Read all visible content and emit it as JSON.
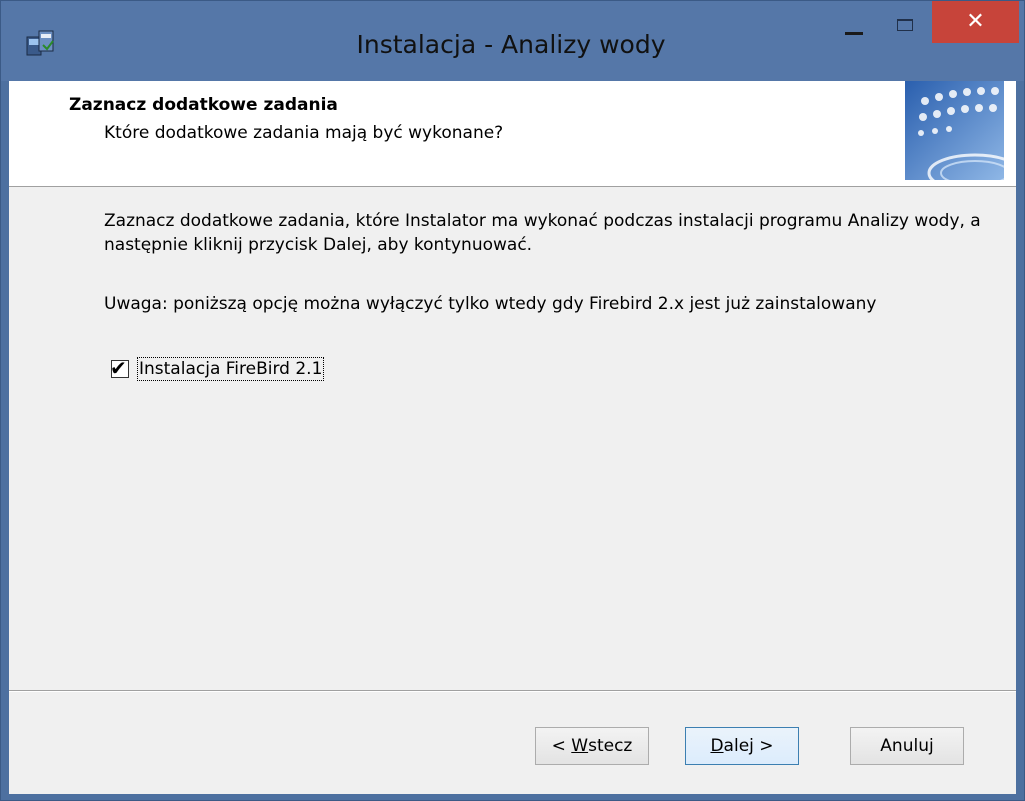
{
  "window": {
    "title": "Instalacja - Analizy wody",
    "close_glyph": "✕"
  },
  "header": {
    "title": "Zaznacz dodatkowe zadania",
    "subtitle": "Które dodatkowe zadania mają być wykonane?"
  },
  "body": {
    "description": "Zaznacz dodatkowe zadania, które Instalator ma wykonać podczas instalacji programu Analizy wody, a następnie kliknij przycisk Dalej, aby kontynuować.",
    "note": "Uwaga: poniższą opcję można wyłączyć tylko wtedy gdy Firebird 2.x jest już zainstalowany",
    "task": {
      "label": "Instalacja FireBird 2.1",
      "checked": true
    }
  },
  "buttons": {
    "back_prefix": "< ",
    "back_mnemonic": "W",
    "back_rest": "stecz",
    "next_mnemonic": "D",
    "next_rest": "alej >",
    "cancel": "Anuluj"
  },
  "colors": {
    "title_bar": "#5577a8",
    "close_button": "#c7443a",
    "dialog_bg": "#f0f0f0"
  },
  "icons": {
    "app": "installer-icon",
    "check": "checkmark-icon"
  }
}
